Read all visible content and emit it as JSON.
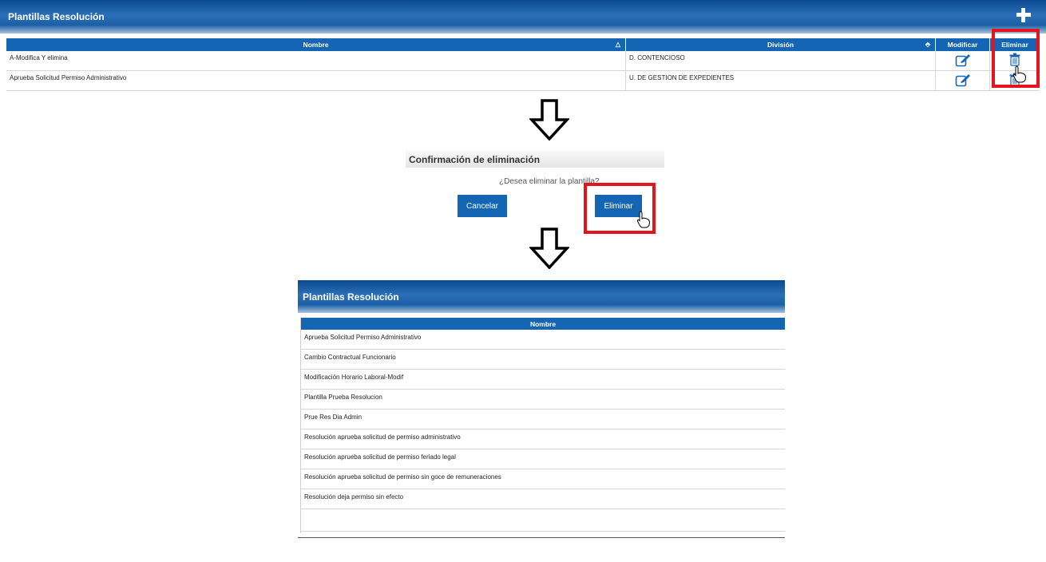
{
  "top_panel": {
    "title": "Plantillas Resolución",
    "columns": {
      "nombre": "Nombre",
      "division": "División",
      "modificar": "Modificar",
      "eliminar": "Eliminar"
    },
    "rows": [
      {
        "nombre": "A-Modifica Y elimina",
        "division": "D. CONTENCIOSO"
      },
      {
        "nombre": "Aprueba Solicitud Permiso Administrativo",
        "division": "U. DE GESTION DE EXPEDIENTES"
      }
    ],
    "icons": {
      "add": "plus-icon",
      "modify": "edit-icon",
      "delete": "trash-icon",
      "sort_asc": "sort-up-icon",
      "sort_both": "sort-both-icon"
    }
  },
  "dialog": {
    "title": "Confirmación de eliminación",
    "message": "¿Desea eliminar la plantilla?",
    "cancel_label": "Cancelar",
    "delete_label": "Eliminar"
  },
  "bottom_panel": {
    "title": "Plantillas Resolución",
    "column": "Nombre",
    "rows": [
      "Aprueba Solicitud Permiso Administrativo",
      "Cambio Contractual Funcionario",
      "Modificación Horario Laboral-Modif",
      "Plantilla Prueba Resolucion",
      "Prue Res Dia Admin",
      "Resolución aprueba solicitud de permiso administrativo",
      "Resolución aprueba solicitud de permiso feriado legal",
      "Resolución aprueba solicitud de permiso sin goce de remuneraciones",
      "Resolución deja permiso sin efecto"
    ]
  },
  "colors": {
    "accent_blue": "#1565b5",
    "highlight_red": "#e3141e"
  }
}
